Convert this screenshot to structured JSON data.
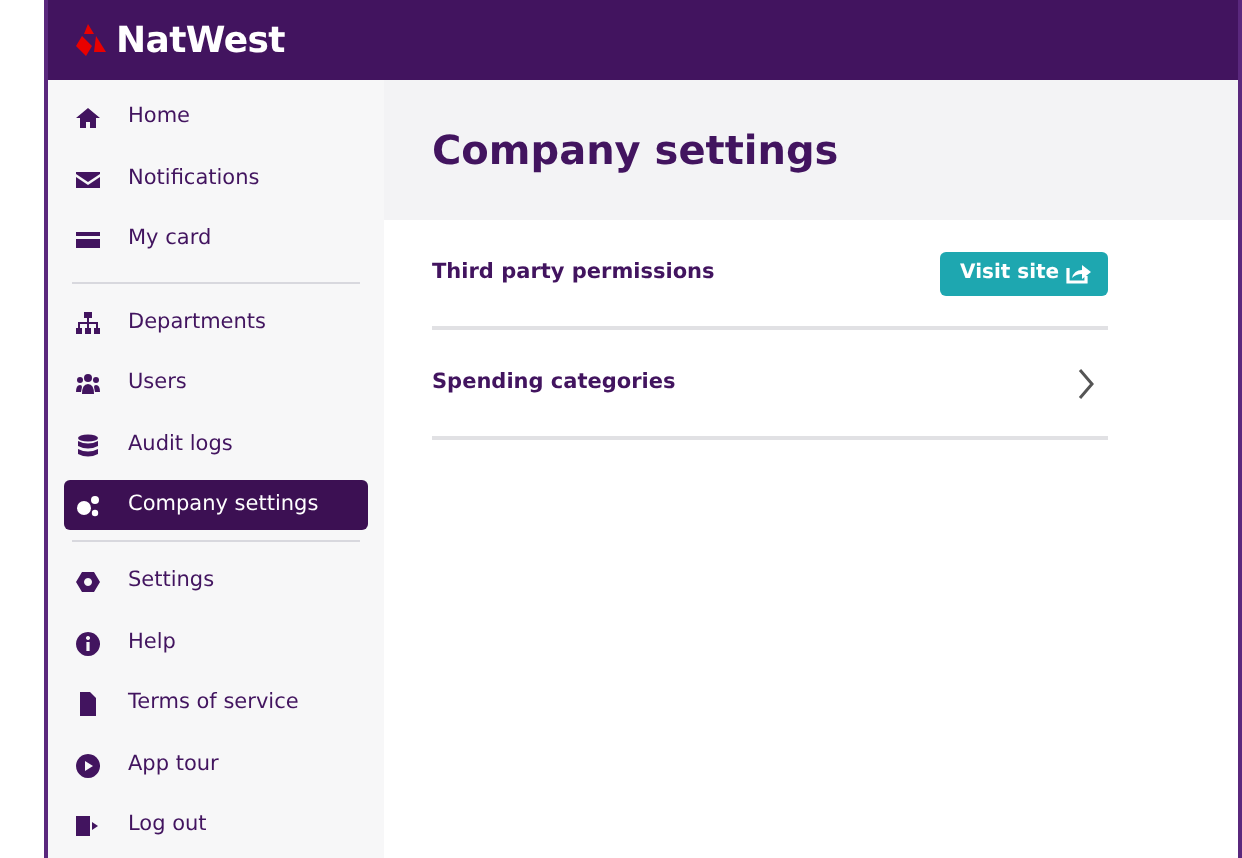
{
  "brand": "NatWest",
  "sidebar": {
    "groups": [
      {
        "items": [
          {
            "label": "Home",
            "selected": false
          },
          {
            "label": "Notifications",
            "selected": false
          },
          {
            "label": "My card",
            "selected": false
          }
        ]
      },
      {
        "items": [
          {
            "label": "Departments",
            "selected": false
          },
          {
            "label": "Users",
            "selected": false
          },
          {
            "label": "Audit logs",
            "selected": false
          },
          {
            "label": "Company settings",
            "selected": true
          }
        ]
      },
      {
        "items": [
          {
            "label": "Settings",
            "selected": false
          },
          {
            "label": "Help",
            "selected": false
          },
          {
            "label": "Terms of service",
            "selected": false
          },
          {
            "label": "App tour",
            "selected": false
          },
          {
            "label": "Log out",
            "selected": false
          }
        ]
      }
    ]
  },
  "page": {
    "title": "Company settings",
    "rows": [
      {
        "kind": "external",
        "label": "Third party permissions",
        "button": "Visit site"
      },
      {
        "kind": "chevron",
        "label": "Spending categories"
      }
    ]
  }
}
